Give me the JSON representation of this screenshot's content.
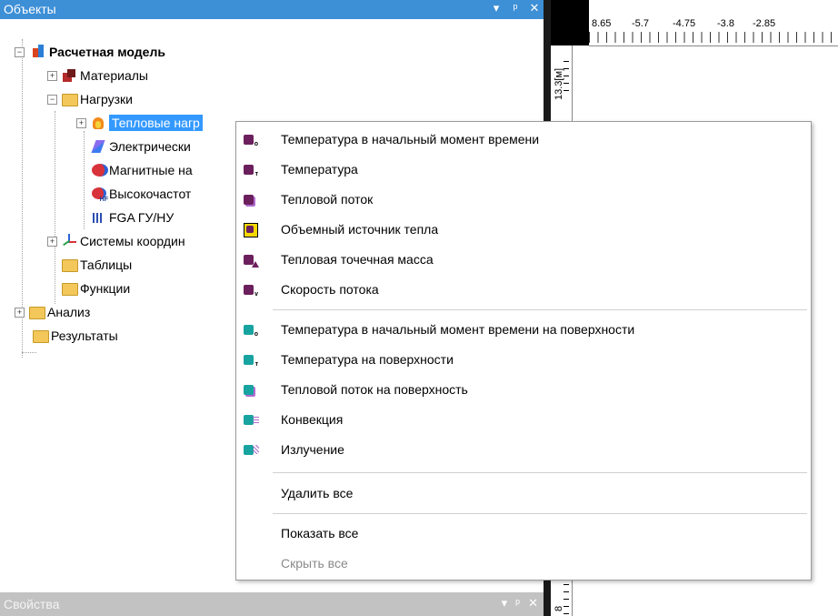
{
  "objects_panel": {
    "title": "Объекты",
    "ctrl_dropdown": "▾",
    "ctrl_pin": "ᵖ",
    "ctrl_close": "✕"
  },
  "tree": {
    "root": "Расчетная модель",
    "materials": "Материалы",
    "loads": "Нагрузки",
    "thermal": "Тепловые нагр",
    "electric": "Электрически",
    "magnetic": "Магнитные на",
    "high_freq": "Высокочастот",
    "fga": "FGA ГУ/НУ",
    "coord": "Системы координ",
    "tables": "Таблицы",
    "functions": "Функции",
    "analysis": "Анализ",
    "results": "Результаты"
  },
  "ruler": {
    "top_labels": [
      "8.65",
      "-5.7",
      "-4.75",
      "-3.8",
      "-2.85"
    ],
    "left_label_1": "13.3[м]",
    "left_label_2": "8"
  },
  "properties_panel": {
    "title": "Свойства",
    "ctrl_dropdown": "▾",
    "ctrl_pin": "ᵖ",
    "ctrl_close": "✕"
  },
  "context_menu": {
    "items": [
      {
        "label": "Температура в начальный момент времени",
        "icon": "cube-initial-temp-icon"
      },
      {
        "label": "Температура",
        "icon": "cube-temp-icon"
      },
      {
        "label": "Тепловой поток",
        "icon": "cube-heat-flux-icon"
      },
      {
        "label": "Объемный источник тепла",
        "icon": "volume-heat-source-icon"
      },
      {
        "label": "Тепловая точечная масса",
        "icon": "point-mass-icon"
      },
      {
        "label": "Скорость потока",
        "icon": "flow-velocity-icon"
      },
      {
        "label": "Температура в начальный момент времени на поверхности",
        "icon": "surface-initial-temp-icon"
      },
      {
        "label": "Температура на поверхности",
        "icon": "surface-temp-icon"
      },
      {
        "label": "Тепловой поток на поверхность",
        "icon": "surface-heat-flux-icon"
      },
      {
        "label": "Конвекция",
        "icon": "convection-icon"
      },
      {
        "label": "Излучение",
        "icon": "radiation-icon"
      },
      {
        "label": "Удалить все",
        "icon": ""
      },
      {
        "label": "Показать все",
        "icon": ""
      },
      {
        "label": "Скрыть все",
        "icon": "",
        "disabled": true
      }
    ]
  },
  "colors": {
    "title_bar": "#3d8fd6",
    "selection": "#3399ff",
    "solid_cube": "#6b1f5c",
    "surface_cube": "#17a3a0",
    "inactive_bar": "#c2c2c2"
  }
}
